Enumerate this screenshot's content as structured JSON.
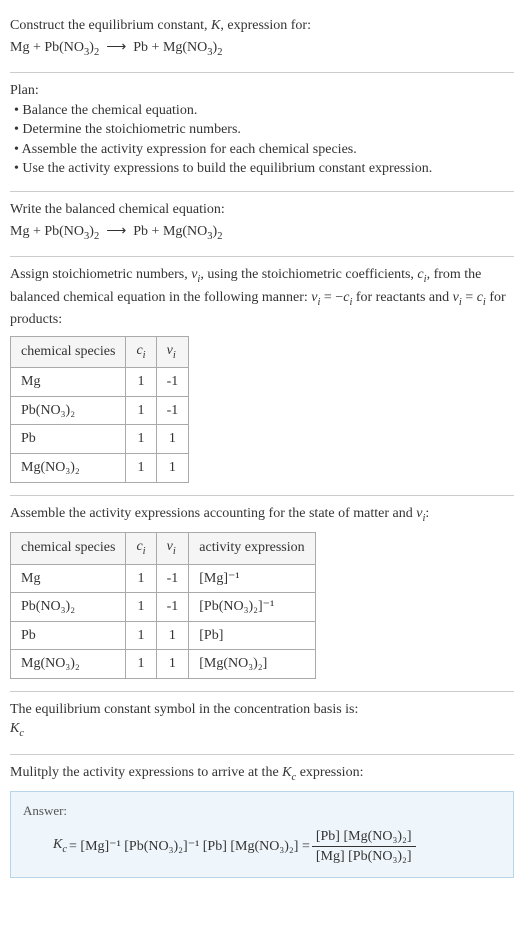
{
  "prompt": {
    "title_a": "Construct the equilibrium constant, ",
    "title_b": ", expression for:",
    "reaction_left": "Mg + Pb(NO",
    "reaction_right": " Pb + Mg(NO",
    "arrow": "⟶"
  },
  "plan": {
    "heading": "Plan:",
    "items": [
      "Balance the chemical equation.",
      "Determine the stoichiometric numbers.",
      "Assemble the activity expression for each chemical species.",
      "Use the activity expressions to build the equilibrium constant expression."
    ]
  },
  "balanced": {
    "heading": "Write the balanced chemical equation:"
  },
  "stoich": {
    "text_a": "Assign stoichiometric numbers, ",
    "text_b": ", using the stoichiometric coefficients, ",
    "text_c": ", from the balanced chemical equation in the following manner: ",
    "text_d": " for reactants and ",
    "text_e": " for products:",
    "headers": [
      "chemical species",
      "cᵢ",
      "νᵢ"
    ],
    "rows": [
      {
        "species": "Mg",
        "ci": "1",
        "vi": "-1"
      },
      {
        "species": "Pb(NO₃)₂",
        "ci": "1",
        "vi": "-1"
      },
      {
        "species": "Pb",
        "ci": "1",
        "vi": "1"
      },
      {
        "species": "Mg(NO₃)₂",
        "ci": "1",
        "vi": "1"
      }
    ]
  },
  "activity": {
    "heading_a": "Assemble the activity expressions accounting for the state of matter and ",
    "heading_b": ":",
    "headers": [
      "chemical species",
      "cᵢ",
      "νᵢ",
      "activity expression"
    ],
    "rows": [
      {
        "species": "Mg",
        "ci": "1",
        "vi": "-1",
        "expr": "[Mg]⁻¹"
      },
      {
        "species": "Pb(NO₃)₂",
        "ci": "1",
        "vi": "-1",
        "expr": "[Pb(NO₃)₂]⁻¹"
      },
      {
        "species": "Pb",
        "ci": "1",
        "vi": "1",
        "expr": "[Pb]"
      },
      {
        "species": "Mg(NO₃)₂",
        "ci": "1",
        "vi": "1",
        "expr": "[Mg(NO₃)₂]"
      }
    ]
  },
  "symbol": {
    "heading": "The equilibrium constant symbol in the concentration basis is:",
    "sym": "K",
    "sub": "c"
  },
  "multiply": {
    "heading_a": "Mulitply the activity expressions to arrive at the ",
    "heading_b": " expression:"
  },
  "answer": {
    "label": "Answer:",
    "kc": "K",
    "kc_sub": "c",
    "eq": " = [Mg]⁻¹ [Pb(NO₃)₂]⁻¹ [Pb] [Mg(NO₃)₂] = ",
    "num": "[Pb] [Mg(NO₃)₂]",
    "den": "[Mg] [Pb(NO₃)₂]"
  },
  "sub32": "3",
  "sub2": "2",
  "K": "K",
  "nu": "ν",
  "ci": "c",
  "i": "i",
  "eq_react": " = −",
  "eq_prod": " = "
}
